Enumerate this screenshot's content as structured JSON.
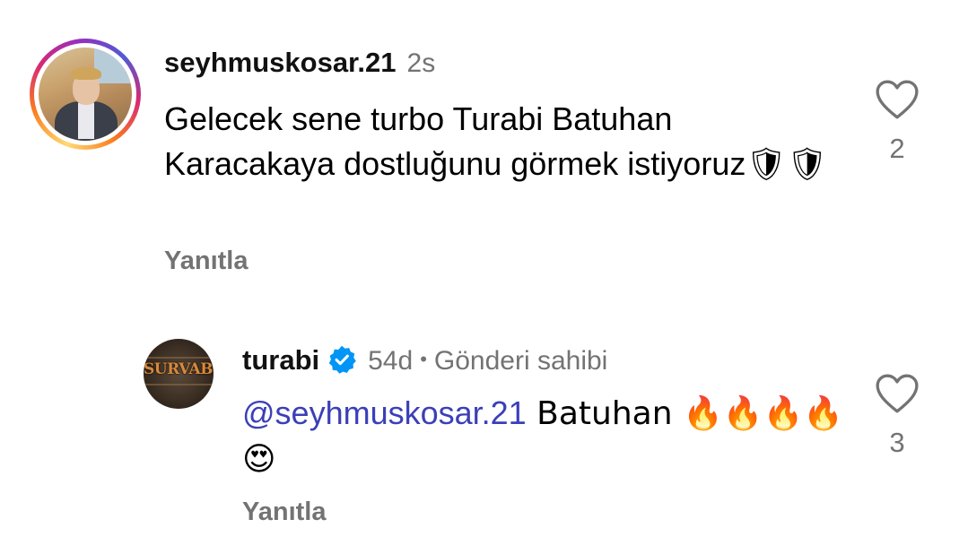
{
  "comments": [
    {
      "username": "seyhmuskosar.21",
      "time": "2s",
      "text": "Gelecek sene turbo Turabi Batuhan Karacakaya dostluğunu görmek istiyoruz",
      "emojis": "🛡🛡",
      "reply_label": "Yanıtla",
      "like_count": "2",
      "has_story_ring": true
    },
    {
      "username": "turabi",
      "verified": true,
      "time": "54d",
      "separator": "•",
      "owner_label": "Gönderi sahibi",
      "mention": "@seyhmuskosar.21",
      "text": " Batuhan 🔥🔥🔥🔥😍",
      "avatar_text": "SURVABI",
      "reply_label": "Yanıtla",
      "like_count": "3"
    }
  ],
  "colors": {
    "secondary_text": "#737373",
    "mention": "#3b3fb8",
    "verified_badge": "#0095f6"
  },
  "icons": [
    "heart-icon",
    "verified-badge-icon",
    "story-ring"
  ]
}
